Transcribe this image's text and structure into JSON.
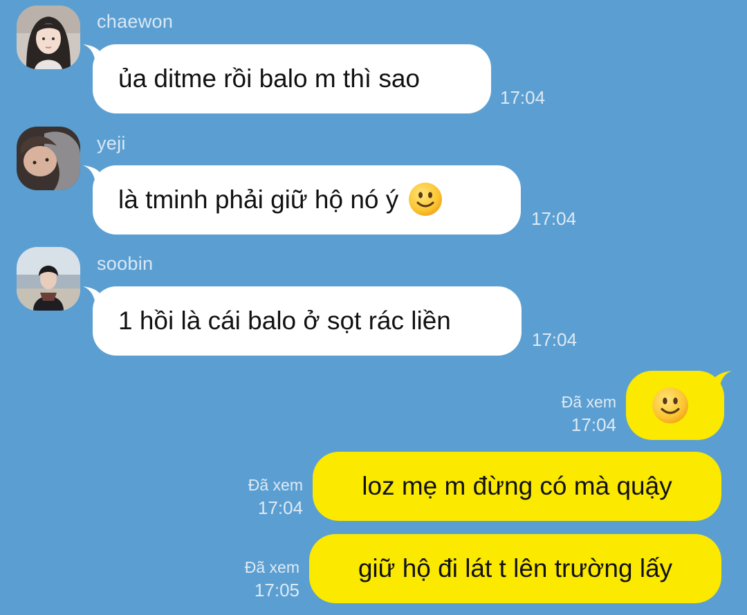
{
  "chat": {
    "messages": [
      {
        "sender": "chaewon",
        "text": "ủa ditme rồi balo m thì sao",
        "time": "17:04"
      },
      {
        "sender": "yeji",
        "text": "là tminh phải giữ hộ nó ý",
        "time": "17:04",
        "emoji": "slightly-smiling-face"
      },
      {
        "sender": "soobin",
        "text": "1 hồi là cái balo ở sọt rác liền",
        "time": "17:04"
      }
    ],
    "outgoing": [
      {
        "emoji": "slightly-smiling-face",
        "read": "Đã xem",
        "time": "17:04"
      },
      {
        "text": "loz mẹ m đừng có mà quậy",
        "read": "Đã xem",
        "time": "17:04"
      },
      {
        "text": "giữ hộ đi lát t lên trường lấy",
        "read": "Đã xem",
        "time": "17:05"
      }
    ]
  },
  "colors": {
    "background": "#5b9fd2",
    "incoming_bubble": "#ffffff",
    "outgoing_bubble": "#fbe900"
  }
}
